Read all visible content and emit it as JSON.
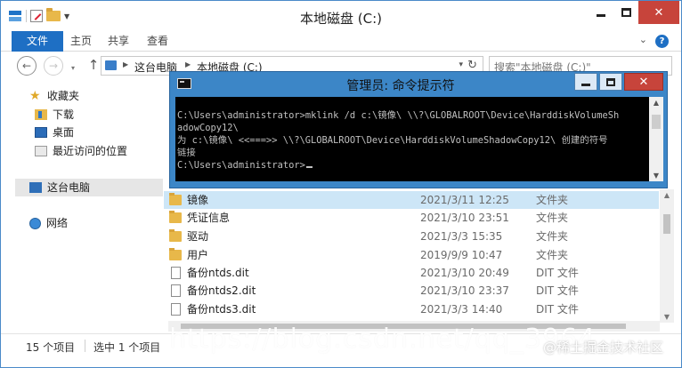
{
  "explorer": {
    "title": "本地磁盘 (C:)",
    "window_controls": {
      "min": "–",
      "max": "□",
      "close": "✕"
    },
    "ribbon": {
      "tabs": [
        {
          "label": "文件"
        },
        {
          "label": "主页"
        },
        {
          "label": "共享"
        },
        {
          "label": "查看"
        }
      ],
      "expand_glyph": "⌄",
      "help_glyph": "?"
    },
    "nav": {
      "back_glyph": "←",
      "forward_glyph": "→",
      "recent_glyph": "▾",
      "up_glyph": "↑",
      "breadcrumbs": [
        "这台电脑",
        "本地磁盘 (C:)"
      ],
      "chevron": "▶",
      "dropdown_glyph": "▾",
      "refresh_glyph": "↻",
      "search_placeholder": "搜索\"本地磁盘 (C:)\""
    },
    "sidebar": {
      "favorites": "收藏夹",
      "items": [
        "下载",
        "桌面",
        "最近访问的位置"
      ],
      "this_pc": "这台电脑",
      "network": "网络"
    },
    "files": [
      {
        "name": "镜像",
        "date": "2021/3/11 12:25",
        "type": "文件夹",
        "kind": "folder",
        "selected": true
      },
      {
        "name": "凭证信息",
        "date": "2021/3/10 23:51",
        "type": "文件夹",
        "kind": "folder"
      },
      {
        "name": "驱动",
        "date": "2021/3/3 15:35",
        "type": "文件夹",
        "kind": "folder"
      },
      {
        "name": "用户",
        "date": "2019/9/9 10:47",
        "type": "文件夹",
        "kind": "folder"
      },
      {
        "name": "备份ntds.dit",
        "date": "2021/3/10 20:49",
        "type": "DIT 文件",
        "kind": "doc"
      },
      {
        "name": "备份ntds2.dit",
        "date": "2021/3/10 23:37",
        "type": "DIT 文件",
        "kind": "doc"
      },
      {
        "name": "备份ntds3.dit",
        "date": "2021/3/3 14:40",
        "type": "DIT 文件",
        "kind": "doc"
      }
    ],
    "status": {
      "count": "15 个项目",
      "selected": "选中 1 个项目"
    }
  },
  "cmd": {
    "title": "管理员: 命令提示符",
    "lines": [
      "C:\\Users\\administrator>mklink /d c:\\镜像\\ \\\\?\\GLOBALROOT\\Device\\HarddiskVolumeSh",
      "adowCopy12\\",
      "为 c:\\镜像\\ <<===>> \\\\?\\GLOBALROOT\\Device\\HarddiskVolumeShadowCopy12\\ 创建的符号",
      "链接",
      "",
      "C:\\Users\\administrator>"
    ],
    "scroll_up": "▲",
    "scroll_down": "▼",
    "close_glyph": "✕"
  },
  "watermark": {
    "url": "https://blog.csdn.net/qq_3964",
    "brand": "@稀土掘金技术社区"
  }
}
